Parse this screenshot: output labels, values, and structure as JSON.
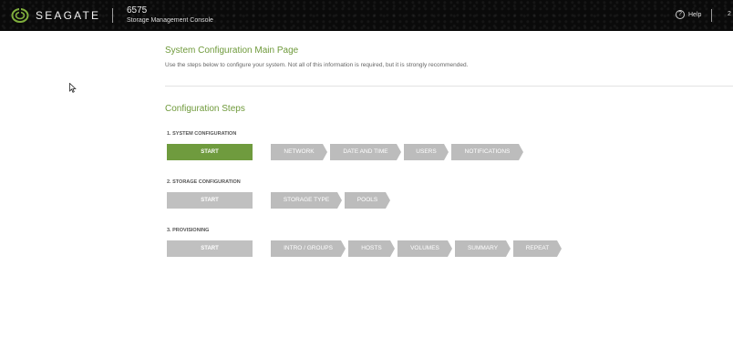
{
  "header": {
    "brand": "SEAGATE",
    "model": "6575",
    "console_name": "Storage Management Console",
    "help_icon_glyph": "?",
    "help_label": "Help",
    "user_initial": "2"
  },
  "page": {
    "title": "System Configuration Main Page",
    "intro": "Use the steps below to configure your system. Not all of this information is required, but it is strongly recommended.",
    "steps_title": "Configuration Steps"
  },
  "sections": [
    {
      "label": "1. SYSTEM CONFIGURATION",
      "start_label": "START",
      "steps": [
        "NETWORK",
        "DATE AND TIME",
        "USERS",
        "NOTIFICATIONS"
      ]
    },
    {
      "label": "2. STORAGE CONFIGURATION",
      "start_label": "START",
      "steps": [
        "STORAGE TYPE",
        "POOLS"
      ]
    },
    {
      "label": "3. PROVISIONING",
      "start_label": "START",
      "steps": [
        "INTRO / GROUPS",
        "HOSTS",
        "VOLUMES",
        "SUMMARY",
        "REPEAT"
      ]
    }
  ],
  "colors": {
    "accent_green": "#6f9b3e",
    "step_gray": "#bcbcbc",
    "header_bg": "#0a0a0a"
  },
  "icons": {
    "logo": "seagate-swirl-icon",
    "help": "help-circle-icon",
    "cursor": "mouse-pointer-icon"
  }
}
